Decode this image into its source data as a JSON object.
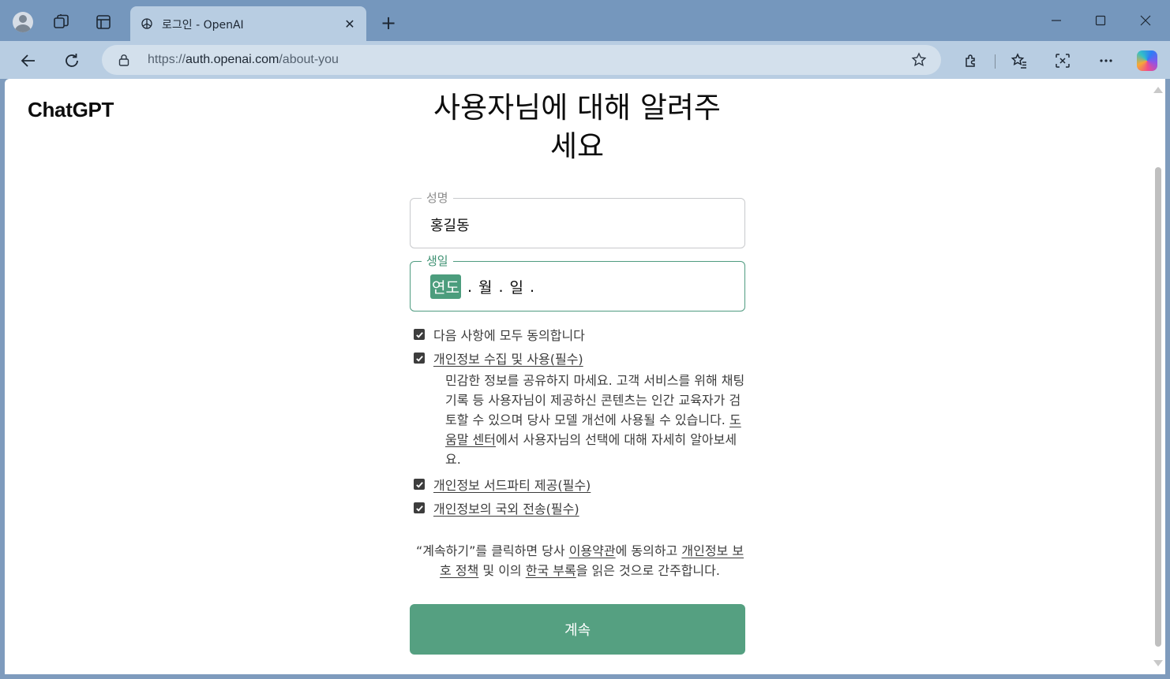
{
  "browser": {
    "tab_title": "로그인 - OpenAI",
    "url_scheme": "https://",
    "url_host": "auth.openai.com",
    "url_path": "/about-you",
    "accent_color": "#7597bd"
  },
  "page": {
    "logo": "ChatGPT",
    "heading_line1": "사용자님에 대해 알려주",
    "heading_line2": "세요",
    "name_field": {
      "label": "성명",
      "value": "홍길동"
    },
    "birthday_field": {
      "label": "생일",
      "year": "연도",
      "month": "월",
      "day": "일",
      "separator": "."
    },
    "consents": {
      "all": "다음 사항에 모두 동의합니다",
      "collection": "개인정보 수집 및 사용(필수)",
      "explain_prefix": "민감한 정보를 공유하지 마세요. 고객 서비스를 위해 채팅 기록 등 사용자님이 제공하신 콘텐츠는 인간 교육자가 검토할 수 있으며 당사 모델 개선에 사용될 수 있습니다. ",
      "help_center_link": "도움말 센터",
      "explain_suffix": "에서 사용자님의 선택에 대해 자세히 알아보세요.",
      "third_party": "개인정보 서드파티 제공(필수)",
      "overseas": "개인정보의 국외 전송(필수)"
    },
    "terms": {
      "prefix": "“계속하기”를 클릭하면 당사 ",
      "tos_link": "이용약관",
      "mid1": "에 동의하고 ",
      "privacy_link": "개인정보 보호 정책",
      "mid2": " 및 이의 ",
      "korea_link": "한국 부록",
      "suffix": "을 읽은 것으로 간주합니다."
    },
    "continue_button": "계속",
    "button_color": "#55a081"
  }
}
